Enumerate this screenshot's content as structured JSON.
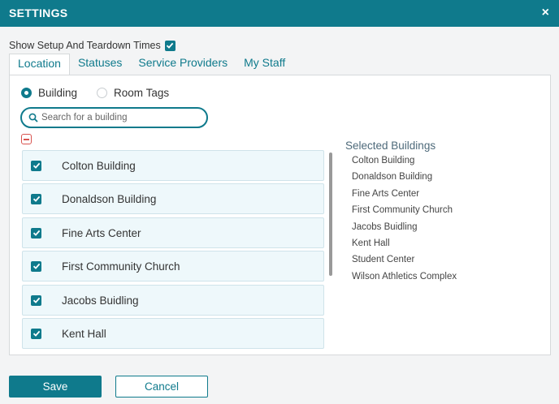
{
  "window": {
    "title": "SETTINGS",
    "close_symbol": "×"
  },
  "setup_times": {
    "label": "Show Setup And Teardown Times",
    "checked": true
  },
  "tabs": [
    {
      "label": "Location",
      "active": true
    },
    {
      "label": "Statuses",
      "active": false
    },
    {
      "label": "Service Providers",
      "active": false
    },
    {
      "label": "My Staff",
      "active": false
    }
  ],
  "mode": {
    "options": [
      {
        "label": "Building",
        "selected": true
      },
      {
        "label": "Room Tags",
        "selected": false
      }
    ]
  },
  "search": {
    "placeholder": "Search for a building",
    "value": ""
  },
  "buildings": [
    {
      "label": "Colton Building",
      "checked": true
    },
    {
      "label": "Donaldson Building",
      "checked": true
    },
    {
      "label": "Fine Arts Center",
      "checked": true
    },
    {
      "label": "First Community Church",
      "checked": true
    },
    {
      "label": "Jacobs Buidling",
      "checked": true
    },
    {
      "label": "Kent Hall",
      "checked": true
    }
  ],
  "selected": {
    "title": "Selected Buildings",
    "items": [
      "Colton Building",
      "Donaldson Building",
      "Fine Arts Center",
      "First Community Church",
      "Jacobs Buidling",
      "Kent Hall",
      "Student Center",
      "Wilson Athletics Complex"
    ]
  },
  "footer": {
    "save_label": "Save",
    "cancel_label": "Cancel"
  },
  "colors": {
    "accent": "#0f7a8c",
    "item_bg": "#eef8fb",
    "danger": "#d9534f"
  }
}
